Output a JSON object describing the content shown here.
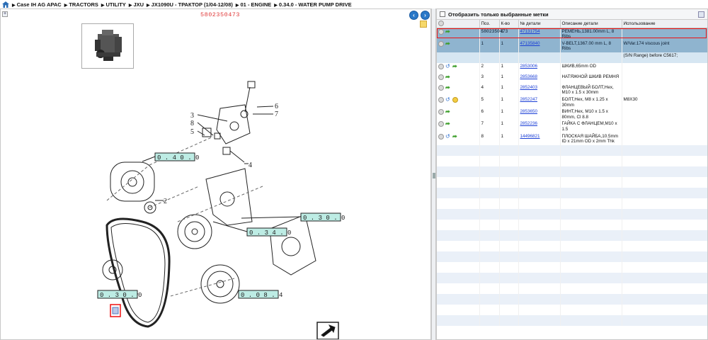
{
  "breadcrumb": {
    "items": [
      "Case IH AG APAC",
      "TRACTORS",
      "UTILITY",
      "JXU",
      "JX1090U - ТРАКТОР (1/04-12/08)",
      "01 - ENGINE",
      "0.34.0 - WATER PUMP DRIVE"
    ]
  },
  "diagram": {
    "part_code": "5802350473",
    "callouts": [
      "0.40.0",
      "0.30.0",
      "0.34.0",
      "0.08.4",
      "0.30.0"
    ],
    "numbers": [
      "2",
      "3",
      "4",
      "5",
      "6",
      "7",
      "8"
    ]
  },
  "filter": {
    "label": "Отобразить только выбранные метки"
  },
  "table": {
    "headers": [
      "",
      "Поз.",
      "К-во",
      "№ детали",
      "Описание детали",
      "Использование"
    ],
    "rows": [
      {
        "icons": [
          "gray",
          "green"
        ],
        "pos": "5802350473",
        "qty": "1",
        "part": "47131754",
        "desc": "РЕМЕНЬ,1381.00mm L, 8 Ribs",
        "usage": "",
        "style": "hl"
      },
      {
        "icons": [
          "gray",
          "green"
        ],
        "pos": "1",
        "qty": "1",
        "part": "47135840",
        "desc": "V-BELT,1367.00 mm L, 8 Ribs",
        "usage": "W/Var.174 viscous joint",
        "style": "hl"
      },
      {
        "icons": [],
        "pos": "",
        "qty": "",
        "part": "",
        "desc": "",
        "usage": "(S/N Range) before C5617;",
        "style": "sel"
      },
      {
        "icons": [
          "gray",
          "blue",
          "green"
        ],
        "pos": "2",
        "qty": "1",
        "part": "2853006",
        "desc": "ШКИВ,65mm OD",
        "usage": "",
        "style": "white"
      },
      {
        "icons": [
          "gray",
          "green"
        ],
        "pos": "3",
        "qty": "1",
        "part": "2853668",
        "desc": "НАТЯЖНОЙ ШКИВ РЕМНЯ",
        "usage": "",
        "style": "white"
      },
      {
        "icons": [
          "gray",
          "green"
        ],
        "pos": "4",
        "qty": "1",
        "part": "2852403",
        "desc": "ФЛАНЦЕВЫЙ БОЛТ,Hex, M10 x 1.5 x 30mm",
        "usage": "",
        "style": "white"
      },
      {
        "icons": [
          "gray",
          "blue",
          "yellow"
        ],
        "pos": "5",
        "qty": "1",
        "part": "2852247",
        "desc": "БОЛТ,Hex, M8 x 1.25 x 30mm",
        "usage": "M8X30",
        "style": "white"
      },
      {
        "icons": [
          "gray",
          "green"
        ],
        "pos": "6",
        "qty": "1",
        "part": "2853650",
        "desc": "ВИНТ,Hex, M10 x 1.5 x 80mm, Cl 8.8",
        "usage": "",
        "style": "white"
      },
      {
        "icons": [
          "gray",
          "green"
        ],
        "pos": "7",
        "qty": "1",
        "part": "2852236",
        "desc": "ГАЙКА С ФЛАНЦЕМ,M10 x 1.5",
        "usage": "",
        "style": "white"
      },
      {
        "icons": [
          "gray",
          "blue",
          "green"
        ],
        "pos": "8",
        "qty": "1",
        "part": "14496821",
        "desc": "ПЛОСКАЯ ШАЙБА,10.5mm ID x 21mm OD x 2mm Thk",
        "usage": "",
        "style": "white"
      }
    ]
  }
}
